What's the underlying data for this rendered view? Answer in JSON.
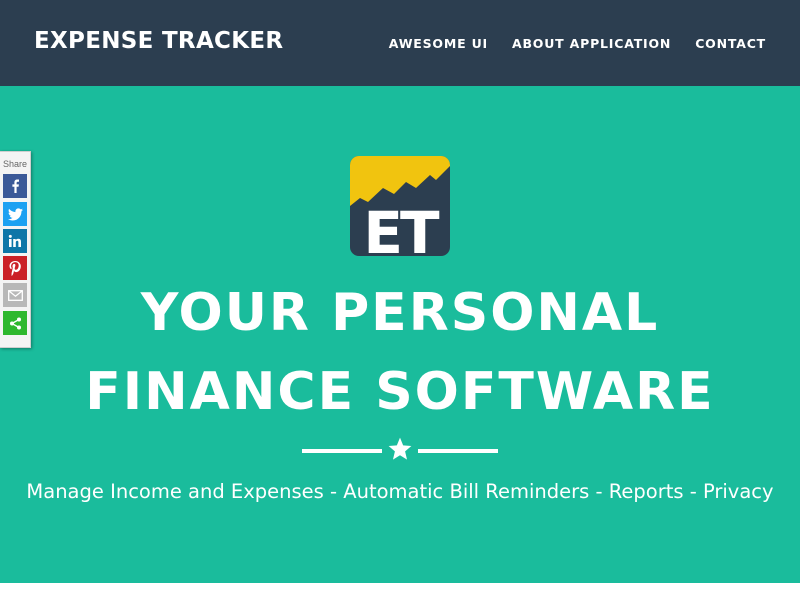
{
  "navbar": {
    "brand": "EXPENSE TRACKER",
    "links": [
      "AWESOME UI",
      "ABOUT APPLICATION",
      "CONTACT"
    ]
  },
  "hero": {
    "logo_text": "ET",
    "headline_line1": "YOUR PERSONAL",
    "headline_line2": "FINANCE SOFTWARE",
    "tagline": "Manage Income and Expenses - Automatic Bill Reminders - Reports - Privacy"
  },
  "share": {
    "label": "Share",
    "buttons": [
      {
        "icon": "facebook-icon",
        "color": "#3b5998"
      },
      {
        "icon": "twitter-icon",
        "color": "#1da1f2"
      },
      {
        "icon": "linkedin-icon",
        "color": "#0e76a8"
      },
      {
        "icon": "pinterest-icon",
        "color": "#cb2027"
      },
      {
        "icon": "email-icon",
        "color": "#b8b8b8"
      },
      {
        "icon": "share-icon",
        "color": "#2eb82e"
      }
    ]
  },
  "colors": {
    "navbar": "#2c3e50",
    "hero": "#1abc9c",
    "logo_dark": "#2c3e50",
    "logo_gold": "#f1c40f"
  }
}
